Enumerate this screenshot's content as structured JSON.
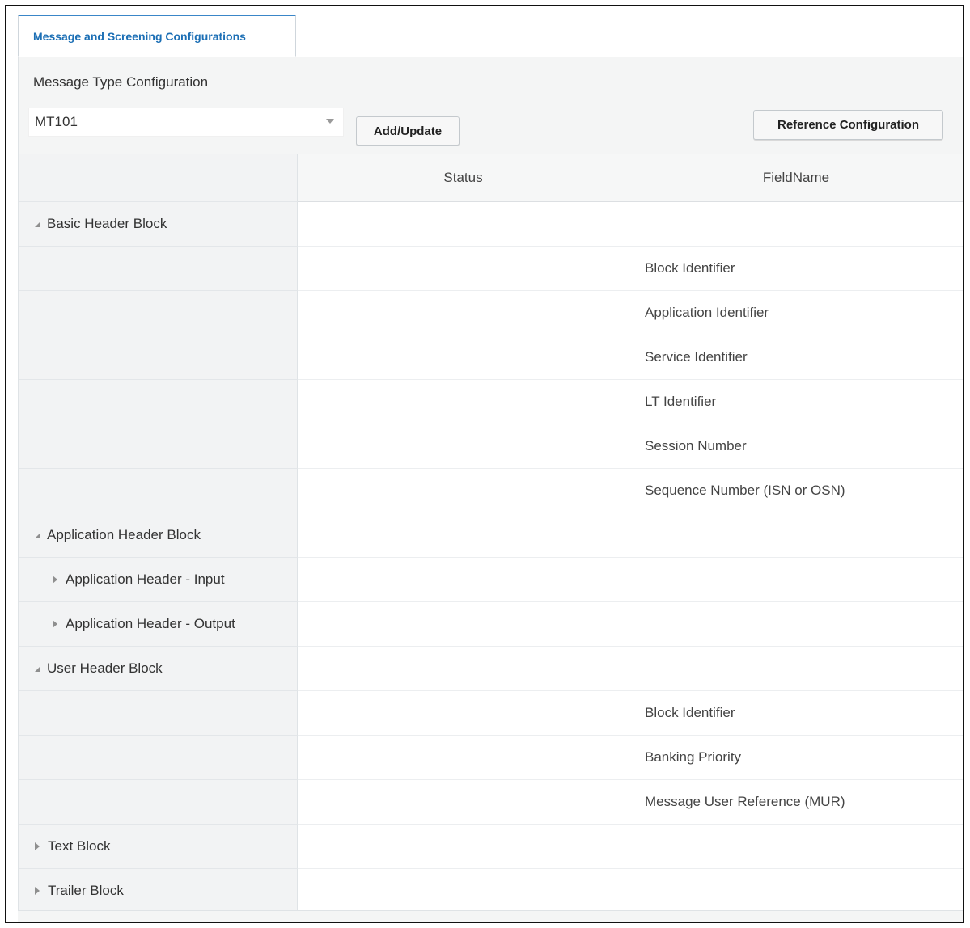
{
  "tab": {
    "label": "Message and Screening Configurations"
  },
  "toolbar": {
    "section_label": "Message Type Configuration",
    "message_type": {
      "selected": "MT101"
    },
    "add_update_label": "Add/Update",
    "reference_configuration_label": "Reference Configuration"
  },
  "grid": {
    "columns": {
      "name": "",
      "status": "Status",
      "field_name": "FieldName"
    },
    "rows": [
      {
        "name": "Basic Header Block",
        "status": "",
        "field_name": ""
      },
      {
        "name": "",
        "status": "",
        "field_name": "Block Identifier"
      },
      {
        "name": "",
        "status": "",
        "field_name": "Application Identifier"
      },
      {
        "name": "",
        "status": "",
        "field_name": "Service Identifier"
      },
      {
        "name": "",
        "status": "",
        "field_name": "LT Identifier"
      },
      {
        "name": "",
        "status": "",
        "field_name": "Session Number"
      },
      {
        "name": "",
        "status": "",
        "field_name": "Sequence Number (ISN or OSN)"
      },
      {
        "name": "Application Header Block",
        "status": "",
        "field_name": ""
      },
      {
        "name": "Application Header - Input",
        "status": "",
        "field_name": ""
      },
      {
        "name": "Application Header - Output",
        "status": "",
        "field_name": ""
      },
      {
        "name": "User Header Block",
        "status": "",
        "field_name": ""
      },
      {
        "name": "",
        "status": "",
        "field_name": "Block Identifier"
      },
      {
        "name": "",
        "status": "",
        "field_name": "Banking Priority"
      },
      {
        "name": "",
        "status": "",
        "field_name": "Message User Reference (MUR)"
      },
      {
        "name": "Text Block",
        "status": "",
        "field_name": ""
      },
      {
        "name": "Trailer Block",
        "status": "",
        "field_name": ""
      }
    ]
  }
}
